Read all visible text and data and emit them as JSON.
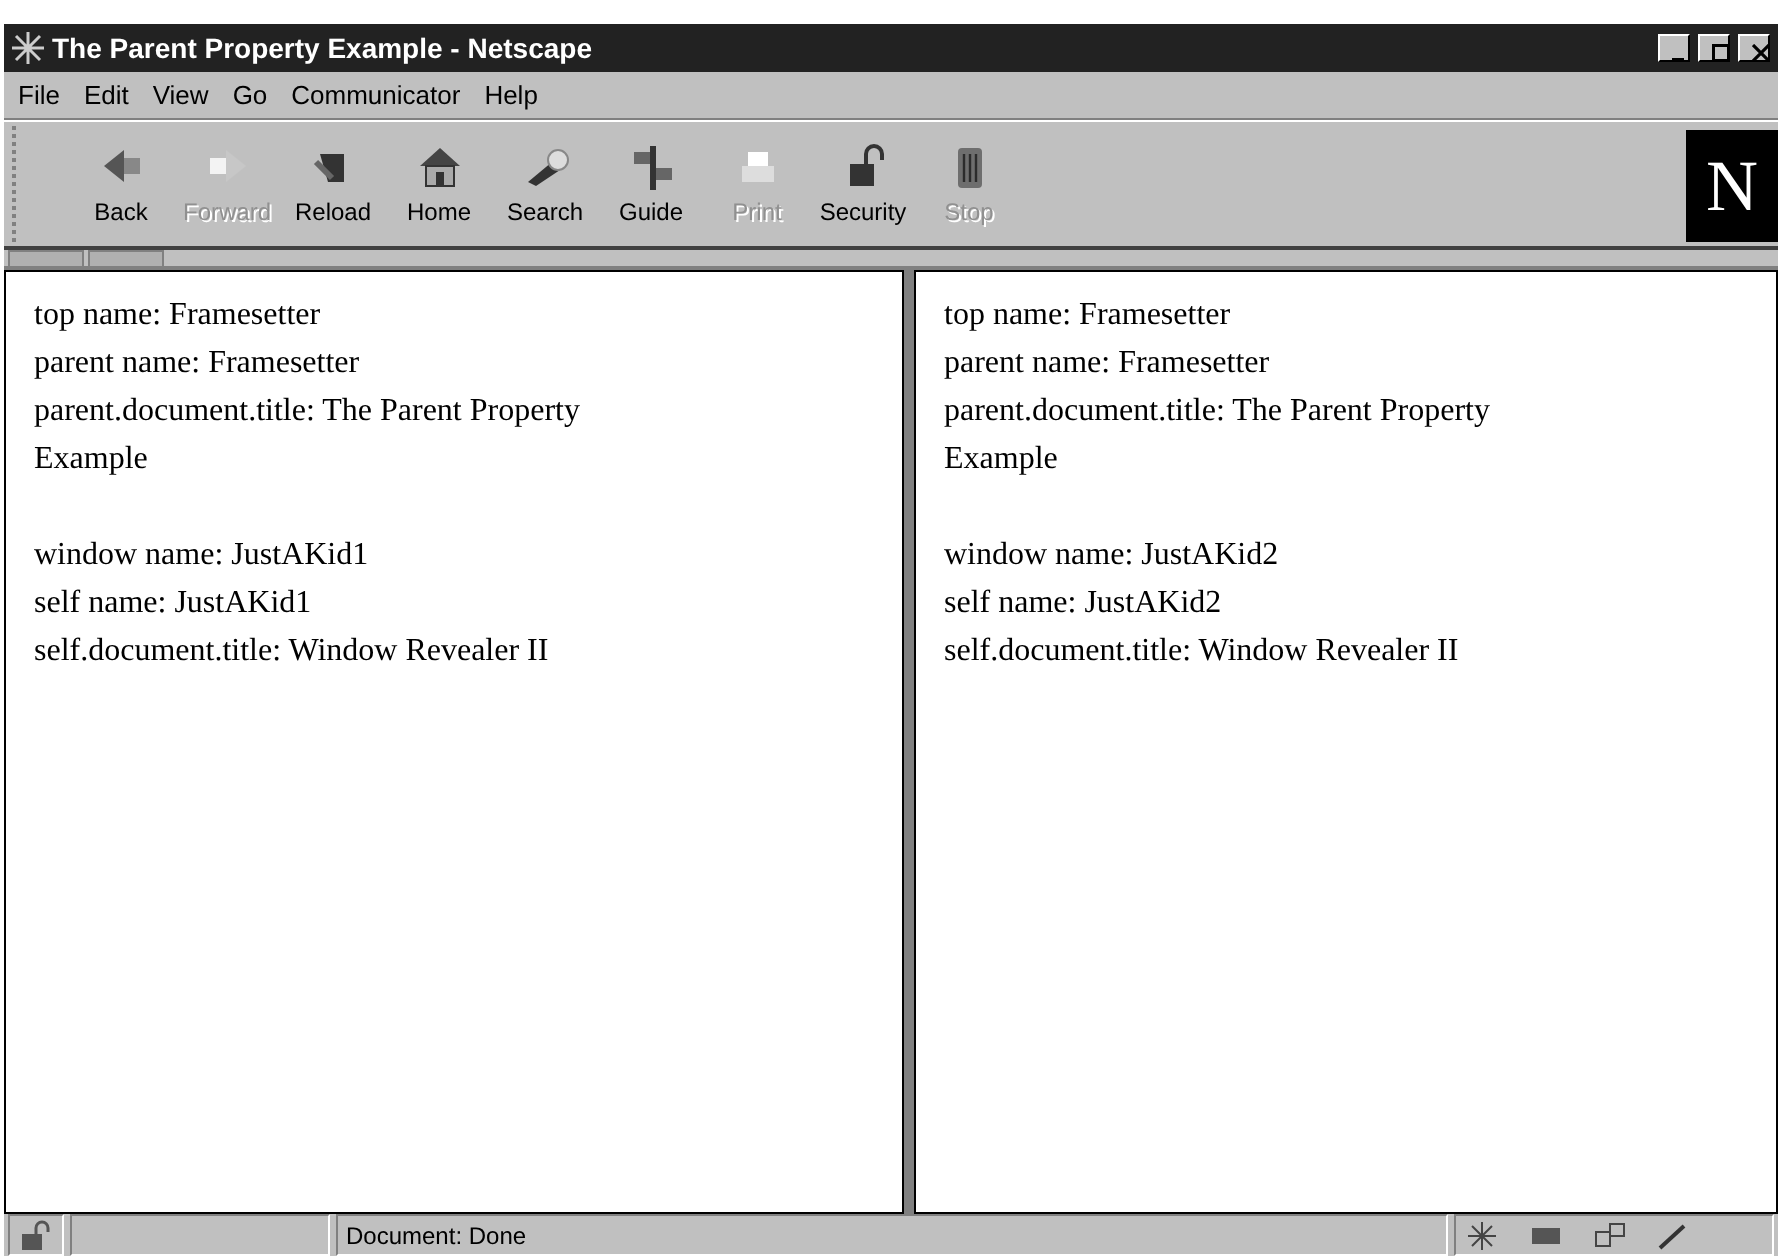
{
  "window": {
    "title": "The Parent Property Example - Netscape"
  },
  "menu": [
    "File",
    "Edit",
    "View",
    "Go",
    "Communicator",
    "Help"
  ],
  "toolbar": [
    {
      "label": "Back",
      "kind": "back",
      "disabled": false
    },
    {
      "label": "Forward",
      "kind": "forward",
      "disabled": true
    },
    {
      "label": "Reload",
      "kind": "reload",
      "disabled": false
    },
    {
      "label": "Home",
      "kind": "home",
      "disabled": false
    },
    {
      "label": "Search",
      "kind": "search",
      "disabled": false
    },
    {
      "label": "Guide",
      "kind": "guide",
      "disabled": false
    },
    {
      "label": "Print",
      "kind": "print",
      "disabled": true
    },
    {
      "label": "Security",
      "kind": "security",
      "disabled": false
    },
    {
      "label": "Stop",
      "kind": "stop",
      "disabled": true
    }
  ],
  "logo": "N",
  "frames": [
    {
      "paragraphs": [
        [
          "top name: Framesetter",
          "parent name: Framesetter",
          "parent.document.title: The Parent Property Example"
        ],
        [
          "window name: JustAKid1",
          "self name: JustAKid1",
          "self.document.title: Window Revealer II"
        ]
      ]
    },
    {
      "paragraphs": [
        [
          "top name: Framesetter",
          "parent name: Framesetter",
          "parent.document.title: The Parent Property Example"
        ],
        [
          "window name: JustAKid2",
          "self name: JustAKid2",
          "self.document.title: Window Revealer II"
        ]
      ]
    }
  ],
  "status_bar": {
    "text": "Document: Done"
  }
}
